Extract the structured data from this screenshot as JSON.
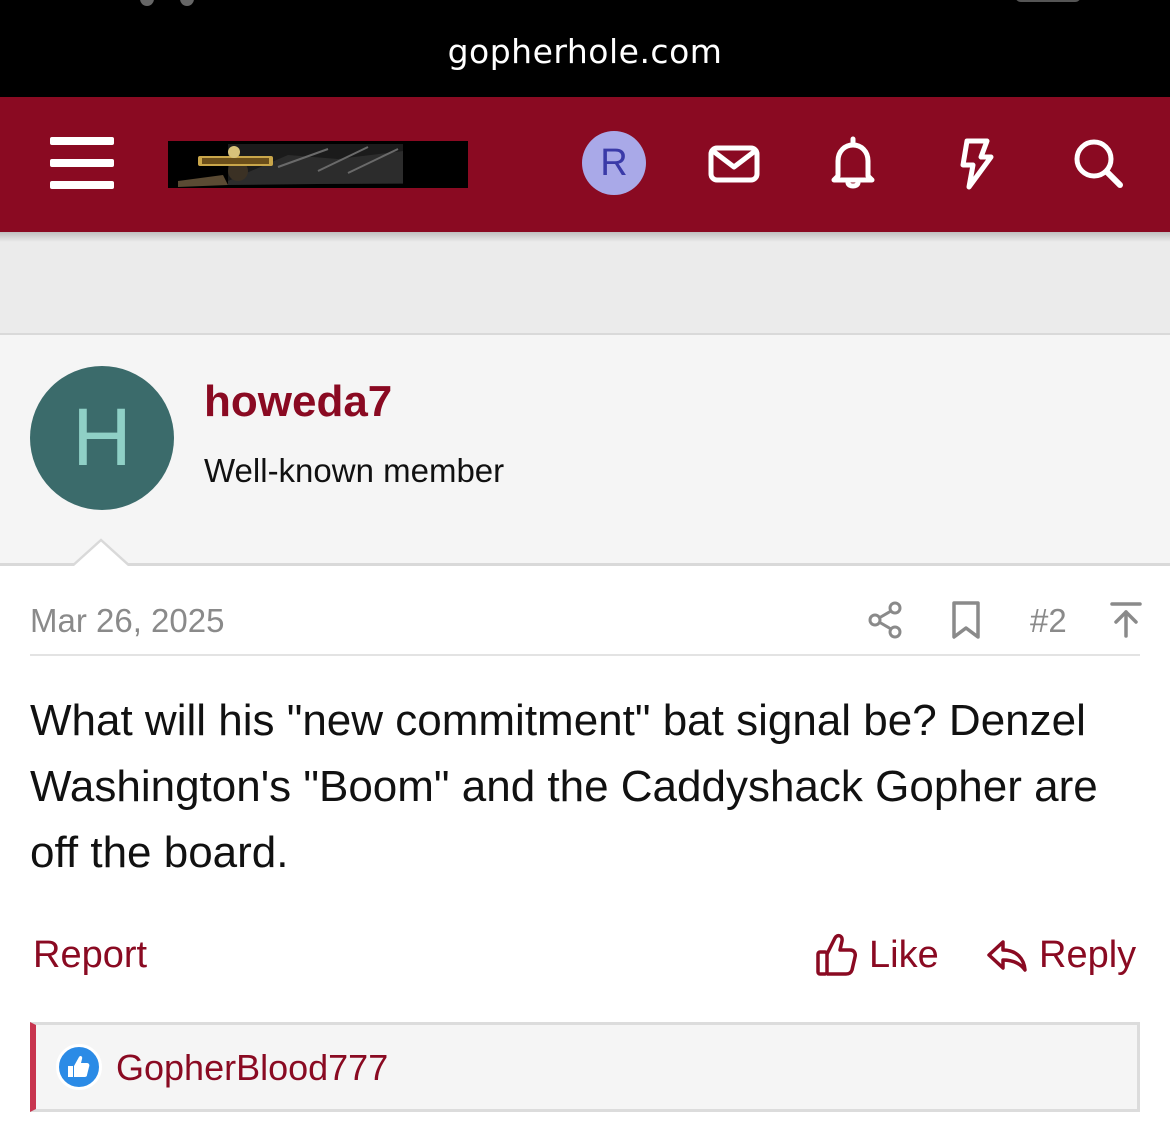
{
  "browser": {
    "url": "gopherhole.com"
  },
  "header": {
    "account_initial": "R",
    "colors": {
      "bar": "#8a0a22",
      "account_avatar_bg": "#a9a9e8"
    },
    "icons": [
      "menu-icon",
      "envelope-icon",
      "bell-icon",
      "bolt-icon",
      "search-icon"
    ]
  },
  "post": {
    "author": {
      "initial": "H",
      "username": "howeda7",
      "title": "Well-known member",
      "avatar_color": "#3b6b6b"
    },
    "date": "Mar 26, 2025",
    "number": "#2",
    "body": "What will his \"new commitment\" bat signal be? Denzel Washington's \"Boom\" and the Caddyshack Gopher are off the board.",
    "actions": {
      "report": "Report",
      "like": "Like",
      "reply": "Reply"
    },
    "reactions": {
      "icon": "thumbs-up-icon",
      "users": "GopherBlood777"
    }
  }
}
